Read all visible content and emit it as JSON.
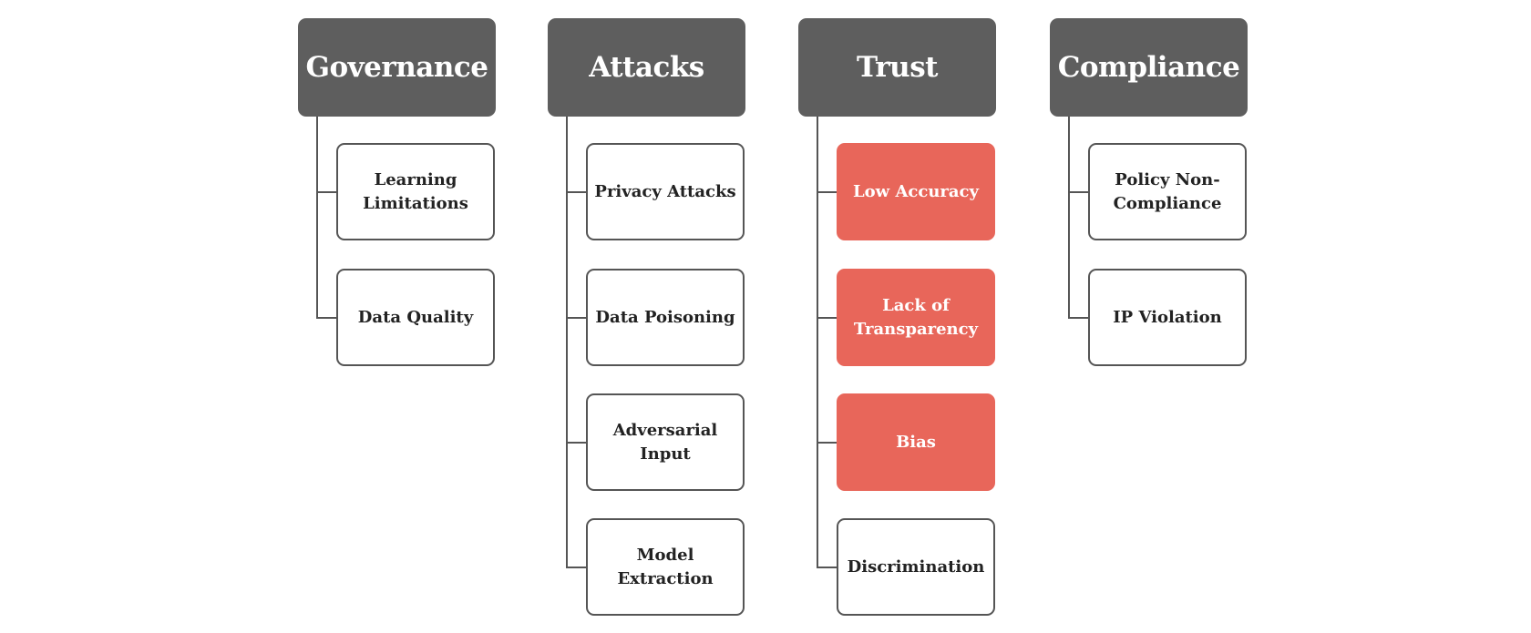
{
  "colors": {
    "header": "#5e5e5e",
    "highlight": "#e8665a",
    "border": "#555555"
  },
  "columns": [
    {
      "title": "Governance",
      "items": [
        {
          "label": "Learning Limitations",
          "highlight": false
        },
        {
          "label": "Data Quality",
          "highlight": false
        }
      ]
    },
    {
      "title": "Attacks",
      "items": [
        {
          "label": "Privacy Attacks",
          "highlight": false
        },
        {
          "label": "Data Poisoning",
          "highlight": false
        },
        {
          "label": "Adversarial Input",
          "highlight": false
        },
        {
          "label": "Model Extraction",
          "highlight": false
        }
      ]
    },
    {
      "title": "Trust",
      "items": [
        {
          "label": "Low Accuracy",
          "highlight": true
        },
        {
          "label": "Lack of Transparency",
          "highlight": true
        },
        {
          "label": "Bias",
          "highlight": true
        },
        {
          "label": "Discrimination",
          "highlight": false
        }
      ]
    },
    {
      "title": "Compliance",
      "items": [
        {
          "label": "Policy Non-Compliance",
          "highlight": false
        },
        {
          "label": "IP Violation",
          "highlight": false
        }
      ]
    }
  ]
}
